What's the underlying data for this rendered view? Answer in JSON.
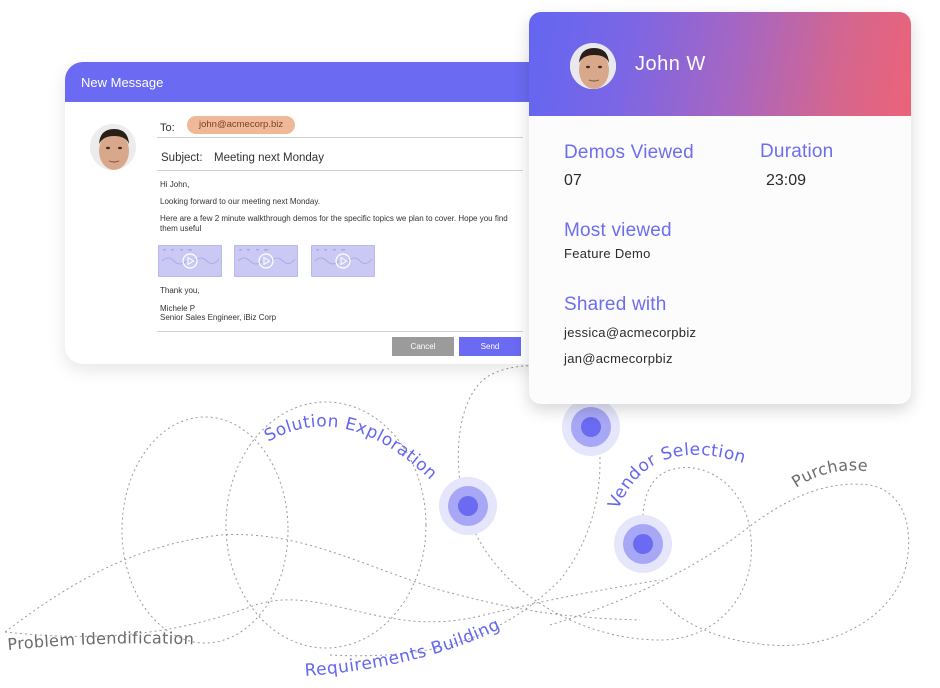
{
  "composer": {
    "title": "New Message",
    "to_label": "To:",
    "to_recipient": "john@acmecorp.biz",
    "subject_label": "Subject:",
    "subject_value": "Meeting next Monday",
    "body": {
      "greeting": "Hi John,",
      "line1": "Looking forward to our meeting next Monday.",
      "line2": "Here are a few 2 minute walkthrough demos for  the specific  topics we plan to cover. Hope you find them useful",
      "closing": "Thank you,",
      "sender_name": "Michele P",
      "sender_title": "Senior Sales Engineer, iBiz Corp"
    },
    "demo_thumbnails": [
      {
        "icon": "play-icon"
      },
      {
        "icon": "play-icon"
      },
      {
        "icon": "play-icon"
      }
    ],
    "cancel_label": "Cancel",
    "send_label": "Send"
  },
  "profile_card": {
    "name": "John W",
    "demos_viewed_label": "Demos Viewed",
    "demos_viewed_value": "07",
    "duration_label": "Duration",
    "duration_value": "23:09",
    "most_viewed_label": "Most viewed",
    "most_viewed_value": "Feature Demo",
    "shared_with_label": "Shared with",
    "shared_with": [
      "jessica@acmecorpbiz",
      "jan@acmecorpbiz"
    ]
  },
  "journey": {
    "stages": [
      {
        "label": "Problem Idendification",
        "color": "gray"
      },
      {
        "label": "Solution Exploration",
        "color": "blue"
      },
      {
        "label": "Requirements Building",
        "color": "blue"
      },
      {
        "label": "Vendor Selection",
        "color": "blue"
      },
      {
        "label": "Purchase",
        "color": "gray"
      }
    ],
    "markers_count": 3
  },
  "colors": {
    "accent": "#6a6af2",
    "chip": "#efb896",
    "gradient_start": "#6366f1",
    "gradient_end": "#ec6378",
    "label_blue": "#6d6df0"
  }
}
